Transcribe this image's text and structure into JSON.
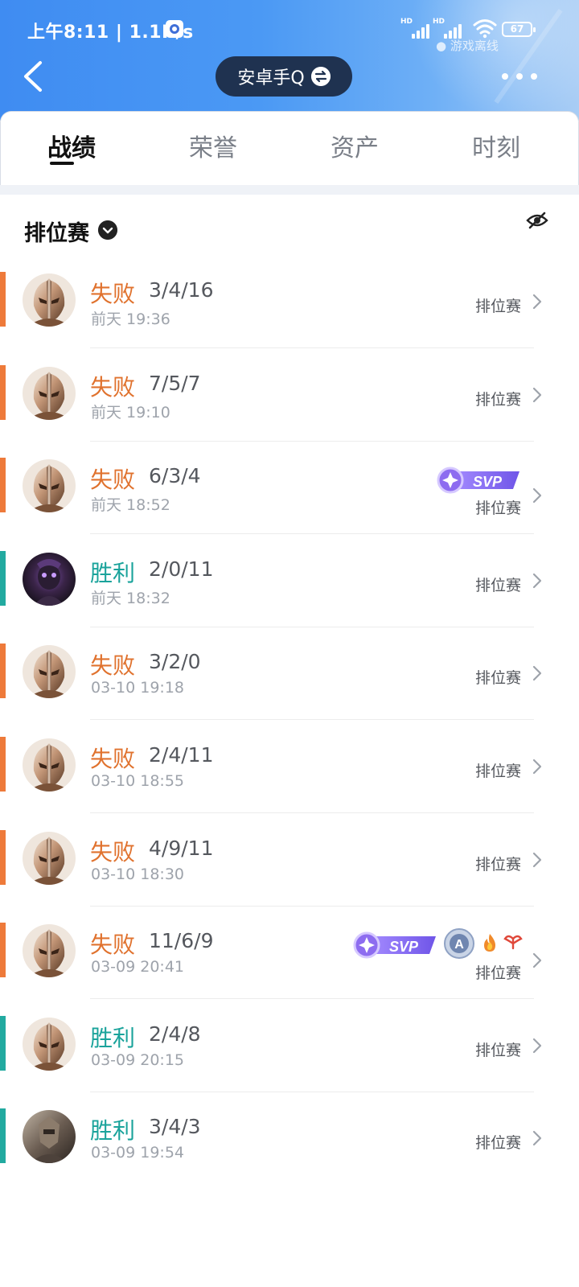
{
  "status_bar": {
    "time": "上午8:11 | 1.1K/s",
    "battery": "67",
    "offline": "游戏离线"
  },
  "header": {
    "account_name": "安卓手Q"
  },
  "tabs": [
    {
      "label": "战绩",
      "active": true
    },
    {
      "label": "荣誉",
      "active": false
    },
    {
      "label": "资产",
      "active": false
    },
    {
      "label": "时刻",
      "active": false
    }
  ],
  "section": {
    "title": "排位赛"
  },
  "records": [
    {
      "result": "失败",
      "outcome": "loss",
      "kda": "3/4/16",
      "time": "前天 19:36",
      "mode": "排位赛",
      "avatar": "bronze-helmet",
      "badges": []
    },
    {
      "result": "失败",
      "outcome": "loss",
      "kda": "7/5/7",
      "time": "前天 19:10",
      "mode": "排位赛",
      "avatar": "bronze-helmet",
      "badges": []
    },
    {
      "result": "失败",
      "outcome": "loss",
      "kda": "6/3/4",
      "time": "前天 18:52",
      "mode": "排位赛",
      "avatar": "bronze-helmet",
      "badges": [
        "SVP"
      ]
    },
    {
      "result": "胜利",
      "outcome": "win",
      "kda": "2/0/11",
      "time": "前天 18:32",
      "mode": "排位赛",
      "avatar": "dark-purple-hero",
      "badges": []
    },
    {
      "result": "失败",
      "outcome": "loss",
      "kda": "3/2/0",
      "time": "03-10 19:18",
      "mode": "排位赛",
      "avatar": "bronze-helmet",
      "badges": []
    },
    {
      "result": "失败",
      "outcome": "loss",
      "kda": "2/4/11",
      "time": "03-10 18:55",
      "mode": "排位赛",
      "avatar": "bronze-helmet",
      "badges": []
    },
    {
      "result": "失败",
      "outcome": "loss",
      "kda": "4/9/11",
      "time": "03-10 18:30",
      "mode": "排位赛",
      "avatar": "bronze-helmet",
      "badges": []
    },
    {
      "result": "失败",
      "outcome": "loss",
      "kda": "11/6/9",
      "time": "03-09 20:41",
      "mode": "排位赛",
      "avatar": "bronze-helmet",
      "badges": [
        "SVP",
        "A",
        "fire",
        "wings"
      ]
    },
    {
      "result": "胜利",
      "outcome": "win",
      "kda": "2/4/8",
      "time": "03-09 20:15",
      "mode": "排位赛",
      "avatar": "bronze-helmet",
      "badges": []
    },
    {
      "result": "胜利",
      "outcome": "win",
      "kda": "3/4/3",
      "time": "03-09 19:54",
      "mode": "排位赛",
      "avatar": "armored-warrior",
      "badges": []
    }
  ],
  "badge_labels": {
    "svp": "SVP",
    "a": "A"
  },
  "colors": {
    "loss": "#e0722e",
    "win": "#1aa39b",
    "header_blue": "#3f8cf2",
    "svp_purple": "#8d6cf0"
  }
}
